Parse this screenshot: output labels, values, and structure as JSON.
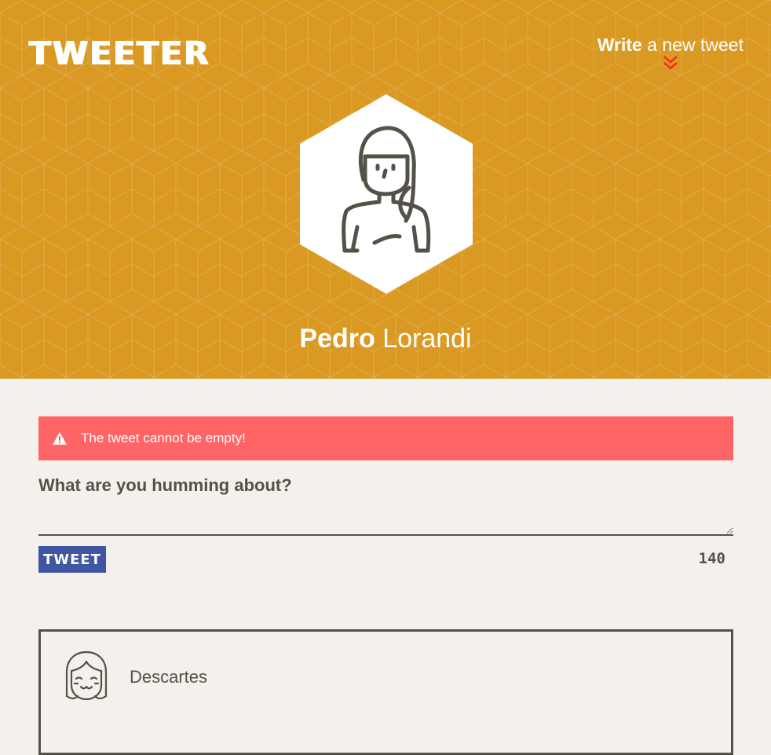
{
  "header": {
    "brand": "TWEETER",
    "compose_toggle": {
      "strong": "Write",
      "rest": "a new tweet",
      "icon": "double-chevron-down-icon"
    },
    "profile": {
      "first_name": "Pedro",
      "last_name": "Lorandi",
      "avatar_icon": "user-avatar-female-icon"
    }
  },
  "compose": {
    "error": {
      "icon": "warning-icon",
      "message": "The tweet cannot be empty!"
    },
    "label": "What are you humming about?",
    "input_value": "",
    "button_label": "TWEET",
    "counter": "140"
  },
  "tweets": [
    {
      "author": "Descartes",
      "avatar_icon": "user-avatar-smiling-icon"
    }
  ],
  "colors": {
    "header_bg": "#d99922",
    "page_bg": "#f4f1ec",
    "error_bg": "#ff6467",
    "button_bg": "#4056a1",
    "chevron": "#ff2a1f",
    "text_dark": "#545149"
  }
}
